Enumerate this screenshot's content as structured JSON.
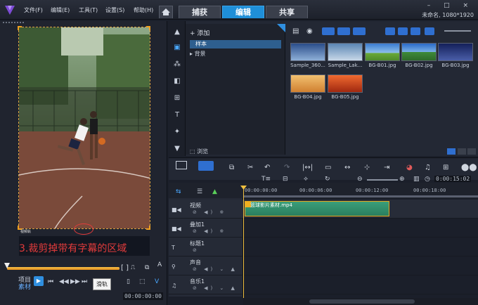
{
  "menu": [
    "文件(F)",
    "编辑(E)",
    "工具(T)",
    "设置(S)",
    "帮助(H)"
  ],
  "tabs": [
    {
      "label": "捕获",
      "active": false
    },
    {
      "label": "编辑",
      "active": true
    },
    {
      "label": "共享",
      "active": false
    }
  ],
  "window": {
    "controls": "– □ ×",
    "project_info": "未命名, 1080*1920"
  },
  "player": {
    "caption": "3.裁剪掉带有字幕的区域",
    "watermark_text": "视频轨",
    "mode_project": "项目",
    "mode_clip": "素材",
    "tooltip": "滑轨",
    "timecode": "00:00:00:00"
  },
  "library": {
    "add_label": "添加",
    "folders": [
      "样本",
      "背景"
    ],
    "browse_label": "浏览",
    "thumbnails": [
      {
        "label": "Sample_360...",
        "color": "#4a78b8"
      },
      {
        "label": "Sample_Lak...",
        "color": "#6a8fb0"
      },
      {
        "label": "BG-B01.jpg",
        "color": "#5b9a42"
      },
      {
        "label": "BG-B02.jpg",
        "color": "#3e8a3a"
      },
      {
        "label": "BG-B03.jpg",
        "color": "#2c3e7a"
      },
      {
        "label": "BG-B04.jpg",
        "color": "#e6a040"
      },
      {
        "label": "BG-B05.jpg",
        "color": "#d2501e"
      }
    ]
  },
  "timeline": {
    "ruler": [
      "00:00:00:00",
      "00:00:06:00",
      "00:00:12:00",
      "00:00:18:00"
    ],
    "zoom_timecode": "0:00:15:02",
    "tracks": [
      {
        "name": "视频",
        "icon": "video-track-icon"
      },
      {
        "name": "叠加1",
        "icon": "overlay-track-icon"
      },
      {
        "name": "标题1",
        "icon": "title-track-icon"
      },
      {
        "name": "声音",
        "icon": "voice-track-icon"
      },
      {
        "name": "音乐1",
        "icon": "music-track-icon"
      }
    ],
    "clip_label": "篮球影片素材.mp4"
  }
}
